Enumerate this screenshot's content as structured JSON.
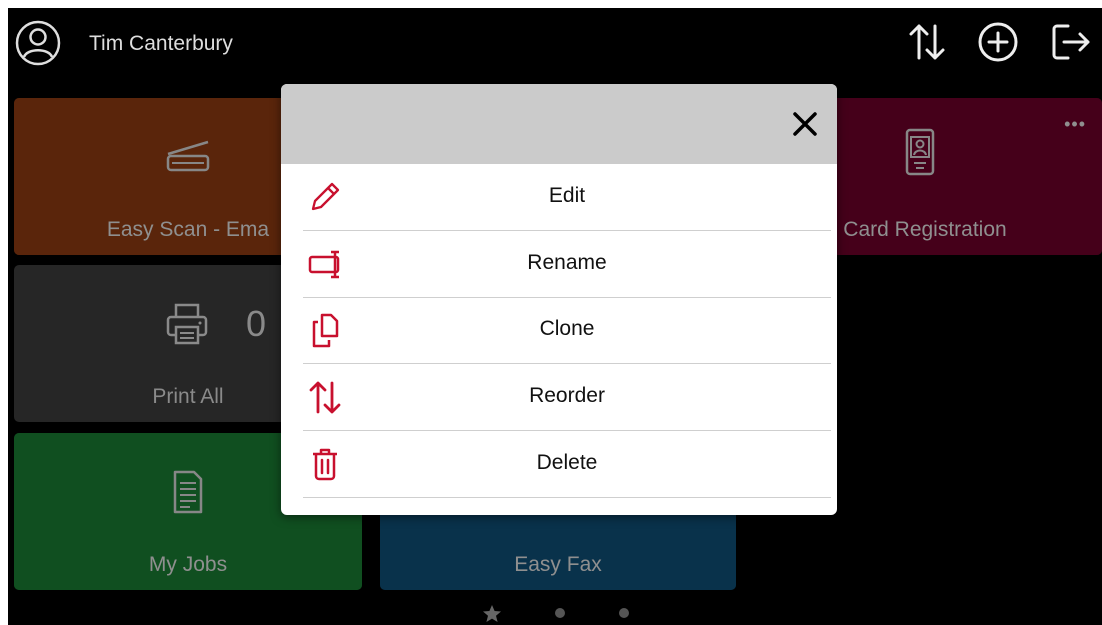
{
  "header": {
    "user_name": "Tim Canterbury",
    "icons": [
      "user-avatar-icon",
      "reorder-icon",
      "add-icon",
      "logout-icon"
    ]
  },
  "tiles": [
    {
      "label": "Easy Scan - Ema",
      "icon": "scanner-icon",
      "color": "#8a3a12"
    },
    {
      "label": "Card Registration",
      "icon": "id-card-icon",
      "color": "#6a0028",
      "menu": "•••"
    },
    {
      "label": "Print All",
      "icon": "printer-icon",
      "color": "#262626",
      "count": "0"
    },
    {
      "label": "My Jobs",
      "icon": "document-icon",
      "color": "#1a7a32"
    },
    {
      "label": "Easy Fax",
      "icon": "fax-icon",
      "color": "#0e4d73"
    }
  ],
  "pager": {
    "current": "star",
    "pages": 3
  },
  "modal": {
    "close_icon": "close-icon",
    "items": [
      {
        "label": "Edit",
        "icon": "pencil-icon"
      },
      {
        "label": "Rename",
        "icon": "rename-icon"
      },
      {
        "label": "Clone",
        "icon": "clone-icon"
      },
      {
        "label": "Reorder",
        "icon": "reorder-icon"
      },
      {
        "label": "Delete",
        "icon": "trash-icon"
      }
    ]
  },
  "colors": {
    "accent": "#c8102e",
    "modal_header": "#cbcbcb"
  }
}
